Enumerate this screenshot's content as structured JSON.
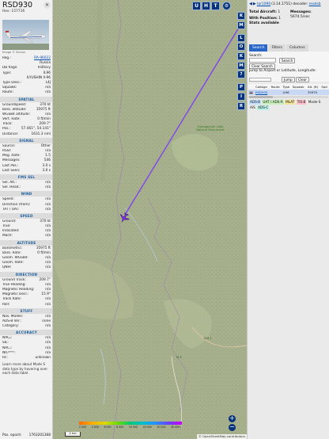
{
  "aircraft": {
    "callsign": "RSD930",
    "hex_line": "Hex: 157716",
    "photo_credit": "Image © Saruss",
    "identity": [
      {
        "label": "Reg.:",
        "value": "RA-96022",
        "link": true
      },
      {
        "label": "",
        "value": "Russia"
      },
      {
        "label": "DB flags:",
        "value": "military"
      },
      {
        "label": "Type:",
        "value": "IL96"
      },
      {
        "label": "",
        "value": "ILYUSHIN Il-96"
      },
      {
        "label": "Type Desc.:",
        "value": "L4J"
      },
      {
        "label": "Squawk:",
        "value": "n/a"
      },
      {
        "label": "Route:",
        "value": "n/a"
      }
    ]
  },
  "sections": [
    {
      "title": "SPATIAL",
      "rows": [
        {
          "label": "Groundspeed:",
          "value": "370 kt"
        },
        {
          "label": "Baro. altitude:",
          "value": "35975 ft"
        },
        {
          "label": "WGS84 altitude:",
          "value": "n/a"
        },
        {
          "label": "Vert. Rate:",
          "value": "0 ft/min"
        },
        {
          "label": "Track:",
          "value": "209.7°"
        },
        {
          "label": "Pos.:",
          "value": "57.461°, 54.141°"
        },
        {
          "label": "Distance:",
          "value": "1631.3 nmi"
        }
      ]
    },
    {
      "title": "SIGNAL",
      "rows": [
        {
          "label": "Source:",
          "value": "Other"
        },
        {
          "label": "RSSI:",
          "value": "n/a"
        },
        {
          "label": "Msg. Rate:",
          "value": "1.5"
        },
        {
          "label": "Messages:",
          "value": "546"
        },
        {
          "label": "Last Pos.:",
          "value": "3.0 s"
        },
        {
          "label": "Last Seen:",
          "value": "3.0 s"
        }
      ]
    },
    {
      "title": "FMS SEL",
      "rows": [
        {
          "label": "Sel. Alt.:",
          "value": "n/a"
        },
        {
          "label": "Sel. Head.:",
          "value": "n/a"
        }
      ]
    },
    {
      "title": "WIND",
      "rows": [
        {
          "label": "Speed:",
          "value": "n/a"
        },
        {
          "label": "Direction (from):",
          "value": "n/a"
        },
        {
          "label": "TAT / OAT:",
          "value": "n/a"
        }
      ]
    },
    {
      "title": "SPEED",
      "rows": [
        {
          "label": "Ground:",
          "value": "370 kt"
        },
        {
          "label": "True:",
          "value": "n/a"
        },
        {
          "label": "Indicated:",
          "value": "n/a"
        },
        {
          "label": "Mach:",
          "value": "n/a"
        }
      ]
    },
    {
      "title": "ALTITUDE",
      "rows": [
        {
          "label": "Barometric:",
          "value": "35975 ft"
        },
        {
          "label": "Baro. Rate:",
          "value": "0 ft/min"
        },
        {
          "label": "Geom. WGS84:",
          "value": "n/a"
        },
        {
          "label": "Geom. Rate:",
          "value": "n/a"
        },
        {
          "label": "QNH:",
          "value": "n/a"
        }
      ]
    },
    {
      "title": "DIRECTION",
      "rows": [
        {
          "label": "Ground Track:",
          "value": "209.7°"
        },
        {
          "label": "True Heading:",
          "value": "n/a"
        },
        {
          "label": "Magnetic Heading:",
          "value": "n/a"
        },
        {
          "label": "Magnetic Decl.:",
          "value": "15.9°"
        },
        {
          "label": "Track Rate:",
          "value": "n/a"
        },
        {
          "label": "Roll:",
          "value": "n/a"
        }
      ]
    },
    {
      "title": "STUFF",
      "rows": [
        {
          "label": "Nav. Modes:",
          "value": "n/a"
        },
        {
          "label": "ADS-B Ver.:",
          "value": "none"
        },
        {
          "label": "Category:",
          "value": "n/a"
        }
      ]
    },
    {
      "title": "ACCURACY",
      "rows": [
        {
          "label": "NACₚ:",
          "value": "n/a"
        },
        {
          "label": "SIL:",
          "value": "n/a"
        },
        {
          "label": "NACᵥ:",
          "value": "n/a"
        },
        {
          "label": "NICᴮᴬᴿᴼ:",
          "value": "n/a"
        },
        {
          "label": "Rc:",
          "value": "unknown"
        }
      ]
    }
  ],
  "note": "Learn more about Mode S data type by hovering over each data label.",
  "footer": {
    "label": "Pos. epoch:",
    "value": "1763201368"
  },
  "map": {
    "top_buttons": [
      "U",
      "H",
      "T"
    ],
    "settings_icon": "gear-icon",
    "side_buttons_a": [
      "K",
      "M"
    ],
    "side_buttons_b": [
      "L",
      "O",
      "K",
      "M",
      "?"
    ],
    "side_buttons_c": [
      "P",
      "I",
      "R"
    ],
    "zoom_in": "+",
    "zoom_out": "−",
    "scale_label": "2 km",
    "legend_ticks": [
      "2 000",
      "4 000",
      "6 000",
      "8 000",
      "10 000",
      "20 000",
      "30 000",
      "40 000+"
    ],
    "attribution": "© OpenStreetMap contributors",
    "labels": {
      "green_area": "Ostrogovnik Lake Natural Monument",
      "road_1": "18Н-1",
      "road_2": "М-3"
    }
  },
  "right": {
    "version_link": "tar1090",
    "version_text": "(3.14.1751) decoder:",
    "decoder_link": "readsb",
    "total_label": "Total Aircraft:",
    "total_value": "1",
    "with_pos_label": "With Position:",
    "with_pos_value": "1",
    "stats_text": "Stats available",
    "messages_label": "Messages:",
    "messages_value": "5674.5/sec",
    "tabs": [
      "Search",
      "Filters",
      "Columns"
    ],
    "search_label": "Search:",
    "search_button": "Search",
    "clear_search": "Clear Search",
    "jump_label": "Jump to Airport or Latitude, Longitude:",
    "jump_button": "Jump",
    "clear_button": "Clear",
    "table_headers": [
      "Flag",
      "Callsign",
      "Route",
      "Type",
      "Squawk",
      "Alt. (ft)",
      "Spd"
    ],
    "table_rows": [
      {
        "callsign": "RSD930",
        "route": "",
        "type": "IL96",
        "squawk": "",
        "alt": "35975",
        "spd": ""
      }
    ],
    "sources": [
      {
        "label": "ADS-B",
        "color": "#c3e0ff"
      },
      {
        "label": "UAT / ADS-R",
        "color": "#c8efbc"
      },
      {
        "label": "MLAT",
        "color": "#f4e39a"
      },
      {
        "label": "TIS-B",
        "color": "#ffc0cb"
      },
      {
        "label": "Mode-S",
        "color": "#eaeaea"
      },
      {
        "label": "AIS",
        "color": "#eaeaea"
      },
      {
        "label": "ADS-C",
        "color": "#b8f0e6"
      }
    ]
  }
}
